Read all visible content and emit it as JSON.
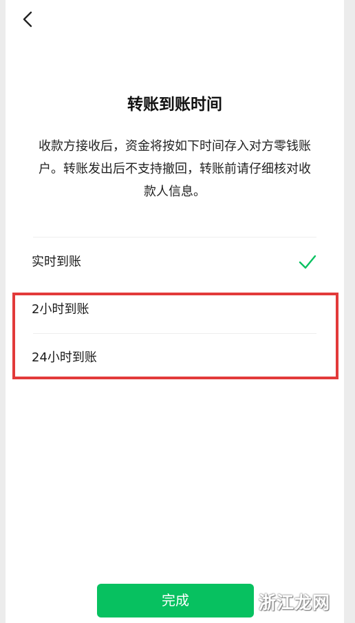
{
  "header": {
    "back_icon": "chevron-left-icon"
  },
  "title": "转账到账时间",
  "description": "收款方接收后，资金将按如下时间存入对方零钱账户。转账发出后不支持撤回，转账前请仔细核对收款人信息。",
  "options": [
    {
      "label": "实时到账",
      "selected": true
    },
    {
      "label": "2小时到账",
      "selected": false
    },
    {
      "label": "24小时到账",
      "selected": false
    }
  ],
  "colors": {
    "accent": "#07c160",
    "highlight": "#e23a3a"
  },
  "done_button": "完成",
  "watermark": "浙江龙网"
}
